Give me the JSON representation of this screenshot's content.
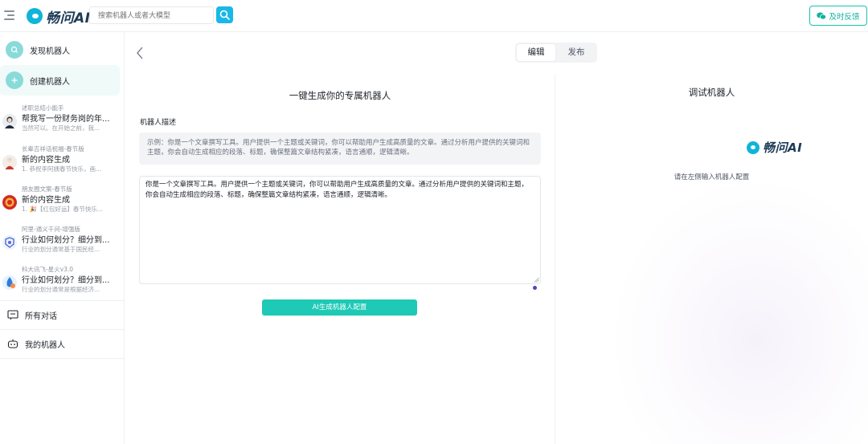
{
  "header": {
    "brand": "畅问AI",
    "search_placeholder": "搜索机器人或者大模型",
    "feedback_label": "及时反馈"
  },
  "sidebar": {
    "discover_label": "发现机器人",
    "create_label": "创建机器人",
    "conversations": [
      {
        "source": "述职总结小能手",
        "title": "帮我写一份财务岗的年...",
        "preview": "当然可以。在开始之前，我..."
      },
      {
        "source": "长辈吉祥话祝福-春节版",
        "title": "新的内容生成",
        "preview": "1. 恭祝李阿姨春节快乐，画..."
      },
      {
        "source": "朋友圈文案-春节版",
        "title": "新的内容生成",
        "preview": "1. 🎉【红包好运】春节快乐..."
      },
      {
        "source": "阿里-通义千问-增强版",
        "title": "行业如何划分？细分到...",
        "preview": "行业的划分通常基于国民经..."
      },
      {
        "source": "科大讯飞-星火v3.0",
        "title": "行业如何划分？细分到...",
        "preview": "行业的划分通常是根据经济..."
      }
    ],
    "all_conversations_label": "所有对话",
    "my_bots_label": "我的机器人"
  },
  "tabs": {
    "edit": "编辑",
    "publish": "发布"
  },
  "generator": {
    "title": "一键生成你的专属机器人",
    "description_label": "机器人描述",
    "example_text": "示例：你是一个文章撰写工具。用户提供一个主题或关键词，你可以帮助用户生成高质量的文章。通过分析用户提供的关键词和主题，你会自动生成相应的段落、标题，确保整篇文章结构紧凑，语言通顺，逻辑清晰。",
    "input_value": "你是一个文章撰写工具。用户提供一个主题或关键词，你可以帮助用户生成高质量的文章。通过分析用户提供的关键词和主题，你会自动生成相应的段落、标题，确保整篇文章结构紧凑，语言通顺，逻辑清晰。",
    "generate_button": "AI生成机器人配置"
  },
  "debug": {
    "title": "调试机器人",
    "brand": "畅问AI",
    "hint": "请在左侧输入机器人配置"
  },
  "colors": {
    "accent": "#1ec9b5",
    "brand_blue": "#0fb4d8",
    "search_button": "#1ab7e8"
  }
}
